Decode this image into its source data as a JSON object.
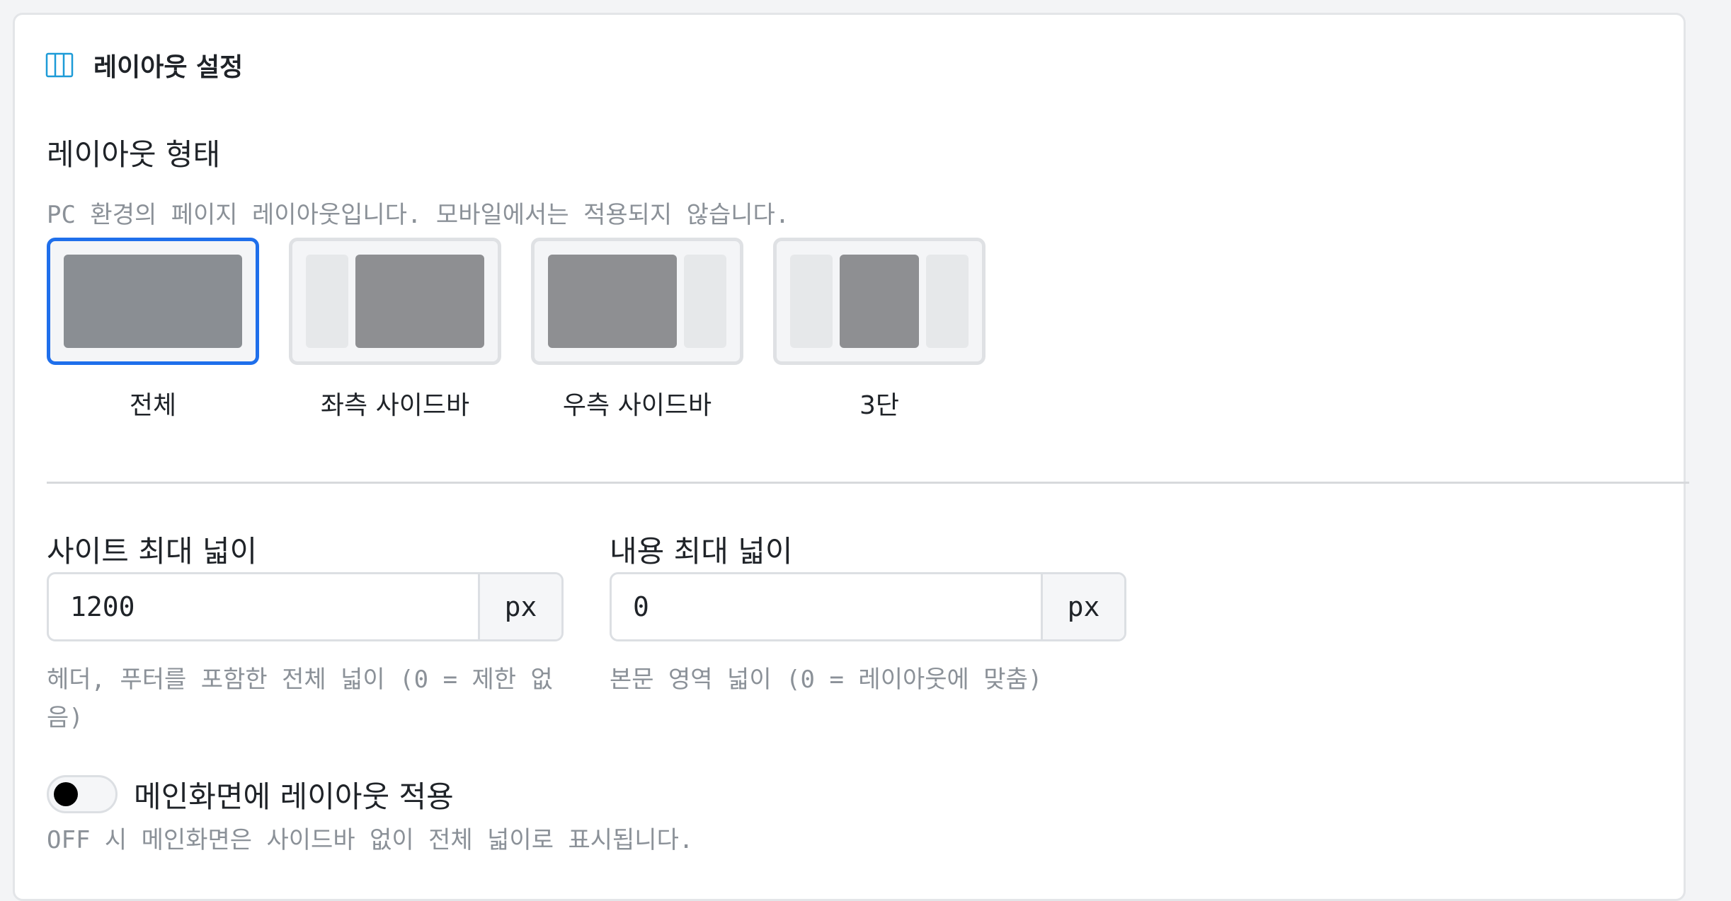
{
  "header": {
    "title": "레이아웃 설정",
    "icon": "columns-icon"
  },
  "layout_type": {
    "label": "레이아웃 형태",
    "hint": "PC 환경의 페이지 레이아웃입니다. 모바일에서는 적용되지 않습니다.",
    "options": [
      {
        "label": "전체",
        "selected": true
      },
      {
        "label": "좌측 사이드바",
        "selected": false
      },
      {
        "label": "우측 사이드바",
        "selected": false
      },
      {
        "label": "3단",
        "selected": false
      }
    ]
  },
  "site_width": {
    "label": "사이트 최대 넓이",
    "value": "1200",
    "unit": "px",
    "hint": "헤더, 푸터를 포함한 전체 넓이 (0 = 제한 없음)"
  },
  "content_width": {
    "label": "내용 최대 넓이",
    "value": "0",
    "unit": "px",
    "hint": "본문 영역 넓이 (0 = 레이아웃에 맞춤)"
  },
  "main_layout_toggle": {
    "label": "메인화면에 레이아웃 적용",
    "state": "OFF",
    "hint": "OFF 시 메인화면은 사이드바 없이 전체 넓이로 표시됩니다."
  },
  "colors": {
    "accent": "#1f6feb",
    "icon": "#1d9bd7",
    "hint_text": "#8b9198",
    "border": "#dcdfe3"
  }
}
